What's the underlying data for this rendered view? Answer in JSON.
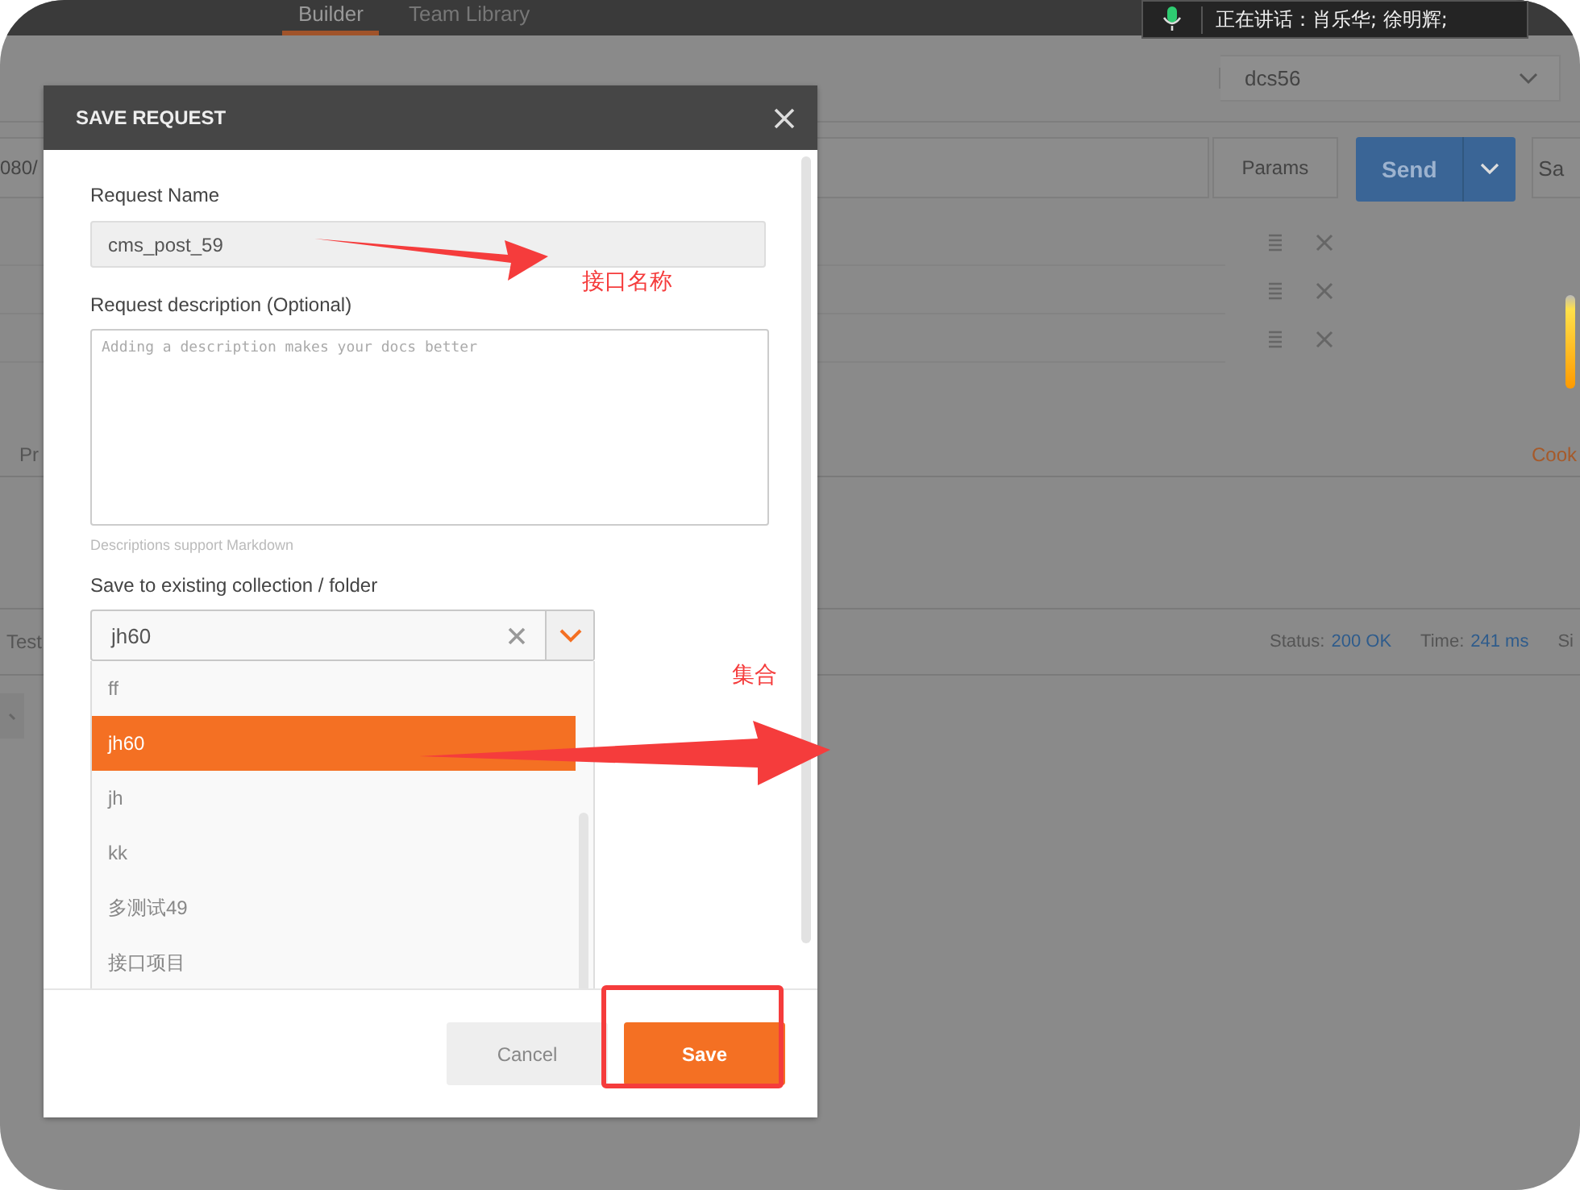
{
  "app": {
    "tabs": [
      {
        "label": "Builder",
        "selected": true
      },
      {
        "label": "Team Library",
        "selected": false
      }
    ],
    "environment": {
      "value": "dcs56"
    },
    "url": {
      "value": "080/"
    },
    "params_button": "Params",
    "send_button": "Send",
    "save_button": "Sa",
    "request_tab": "Pr",
    "cookies_link": "Cook",
    "response_tab": "Test",
    "status_label": "Status:",
    "status_value": "200 OK",
    "time_label": "Time:",
    "time_value": "241 ms",
    "size_label": "Si"
  },
  "voice_overlay": {
    "text": "正在讲话：肖乐华; 徐明辉;"
  },
  "dialog": {
    "title": "SAVE REQUEST",
    "name_label": "Request Name",
    "name_value": "cms_post_59",
    "description_label": "Request description (Optional)",
    "description_placeholder": "Adding a description makes your docs better",
    "description_hint": "Descriptions support Markdown",
    "collection_label": "Save to existing collection / folder",
    "collection_value": "jh60",
    "options": [
      {
        "label": "ff",
        "selected": false
      },
      {
        "label": "jh60",
        "selected": true
      },
      {
        "label": "jh",
        "selected": false
      },
      {
        "label": "kk",
        "selected": false
      },
      {
        "label": "多测试49",
        "selected": false
      },
      {
        "label": "接口项目",
        "selected": false
      }
    ],
    "buttons": [
      {
        "label": "Cancel",
        "kind": "secondary"
      },
      {
        "label": "Save",
        "kind": "primary"
      }
    ]
  },
  "annotations": {
    "name_note": "接口名称",
    "collection_note": "集合"
  }
}
